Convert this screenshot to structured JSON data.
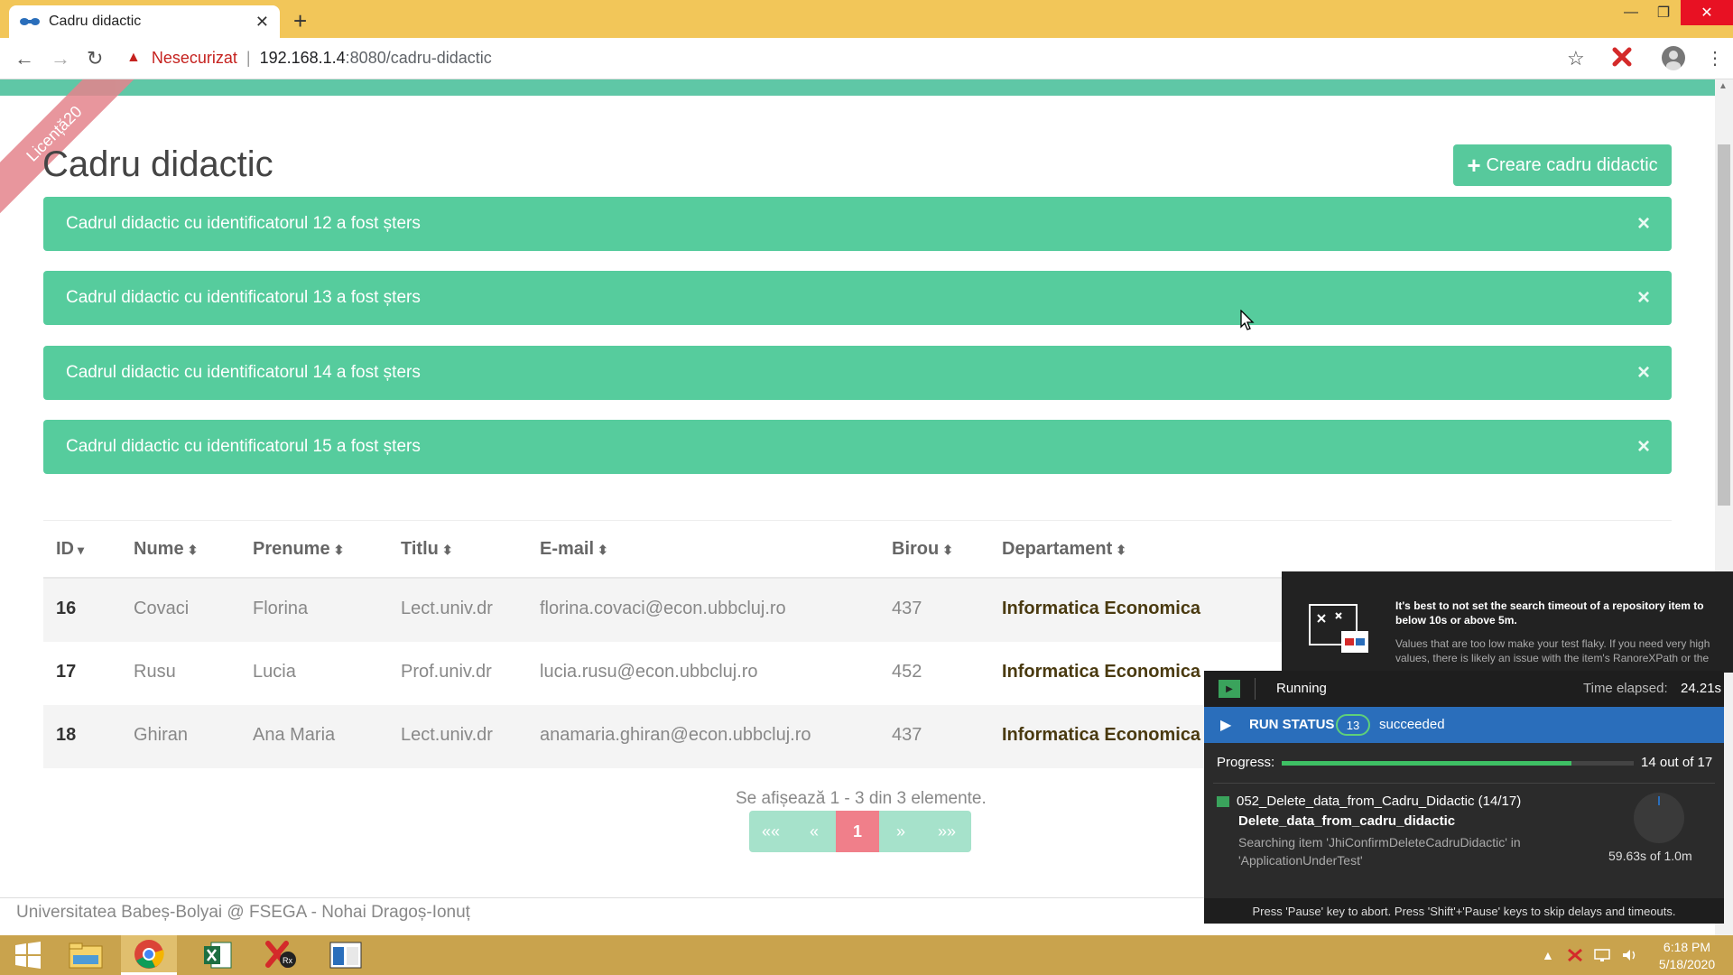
{
  "browser": {
    "tab_title": "Cadru didactic",
    "tab_close": "✕",
    "new_tab": "+",
    "insecure_label": "Nesecurizat",
    "separator": "|",
    "url_host": "192.168.1.4",
    "url_rest": ":8080/cadru-didactic",
    "window_controls": {
      "minimize": "—",
      "maximize": "❐",
      "close": "✕"
    },
    "nav": {
      "back": "←",
      "forward": "→",
      "reload": "↻"
    },
    "icons": [
      "warning-icon",
      "star-icon",
      "ranorex-extension-icon",
      "profile-avatar",
      "menu-icon"
    ]
  },
  "page": {
    "ribbon_text": "Licență20",
    "title": "Cadru didactic",
    "create_button_label": "Creare cadru didactic",
    "create_button_icon": "+",
    "alerts": [
      {
        "text": "Cadrul didactic cu identificatorul 12 a fost șters",
        "close": "×"
      },
      {
        "text": "Cadrul didactic cu identificatorul 13 a fost șters",
        "close": "×"
      },
      {
        "text": "Cadrul didactic cu identificatorul 14 a fost șters",
        "close": "×"
      },
      {
        "text": "Cadrul didactic cu identificatorul 15 a fost șters",
        "close": "×"
      }
    ],
    "table": {
      "columns": [
        {
          "label": "ID",
          "sort": "▾"
        },
        {
          "label": "Nume",
          "sort": "⬍"
        },
        {
          "label": "Prenume",
          "sort": "⬍"
        },
        {
          "label": "Titlu",
          "sort": "⬍"
        },
        {
          "label": "E-mail",
          "sort": "⬍"
        },
        {
          "label": "Birou",
          "sort": "⬍"
        },
        {
          "label": "Departament",
          "sort": "⬍"
        }
      ],
      "rows": [
        {
          "id": "16",
          "nume": "Covaci",
          "prenume": "Florina",
          "titlu": "Lect.univ.dr",
          "email": "florina.covaci@econ.ubbcluj.ro",
          "birou": "437",
          "departament": "Informatica Economica"
        },
        {
          "id": "17",
          "nume": "Rusu",
          "prenume": "Lucia",
          "titlu": "Prof.univ.dr",
          "email": "lucia.rusu@econ.ubbcluj.ro",
          "birou": "452",
          "departament": "Informatica Economica"
        },
        {
          "id": "18",
          "nume": "Ghiran",
          "prenume": "Ana Maria",
          "titlu": "Lect.univ.dr",
          "email": "anamaria.ghiran@econ.ubbcluj.ro",
          "birou": "437",
          "departament": "Informatica Economica"
        }
      ]
    },
    "summary": "Se afișează 1 - 3 din 3 elemente.",
    "pager": {
      "first": "««",
      "prev": "«",
      "current": "1",
      "next": "»",
      "last": "»»"
    },
    "footer": "Universitatea Babeș-Bolyai @ FSEGA - Nohai Dragoș-Ionuț"
  },
  "ranorex": {
    "tip_title": "It's best to not set the search timeout of a repository item to below 10s or above 5m.",
    "tip_body": "Values that are too low make your test flaky. If you need very high values, there is likely an issue with the item's RanoreXPath or the",
    "state": "Running",
    "elapsed_label": "Time elapsed:",
    "elapsed": "24.21s",
    "run_status_label": "RUN STATUS",
    "succeeded_count": "13",
    "succeeded_label": "succeeded",
    "progress_label": "Progress:",
    "progress_fraction": 0.8235,
    "progress_text": "14 out of 17",
    "test_case": "052_Delete_data_from_Cadru_Didactic (14/17)",
    "module": "Delete_data_from_cadru_didactic",
    "searching": "Searching item 'JhiConfirmDeleteCadruDidactic' in 'ApplicationUnderTest'",
    "timeout": "59.63s of 1.0m",
    "footer": "Press 'Pause' key to abort. Press 'Shift'+'Pause' keys to skip delays and timeouts."
  },
  "taskbar": {
    "apps": [
      "windows-start",
      "file-explorer",
      "chrome",
      "excel",
      "ranorex",
      "ranorex-studio"
    ],
    "time": "6:18 PM",
    "date": "5/18/2020"
  },
  "colors": {
    "titlebar": "#f2c659",
    "alert_green": "#56cc9d",
    "button_green": "#57c99c",
    "pager_active": "#f07f8a",
    "ranorex_blue": "#2a6ebb",
    "taskbar": "#c9a34d"
  }
}
